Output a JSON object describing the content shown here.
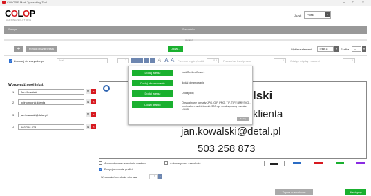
{
  "window": {
    "title": "COLOP E-Mark Typesetting Tool",
    "controls": [
      "–",
      "□",
      "×"
    ]
  },
  "brand": {
    "logo_text": "COLOP",
    "tagline": "MARKING SOLUTIONS"
  },
  "language": {
    "label": "Język",
    "value": "Polski"
  },
  "topbar": {
    "left_tab": "Stempel",
    "center_tab": "Stanowisko"
  },
  "section_label": "stempel",
  "toolbar": {
    "plus_label": "+",
    "new_text_button": "Ponad obszar tekstu",
    "add_button": "Dodaj...",
    "select_element_label": "Wybierz element",
    "select_element_value": "Tekst(1)",
    "font_label": "Szafka",
    "font_value": "—"
  },
  "options_row": {
    "apply_all_label": "Zastosuj do wszystkiego",
    "font_field_placeholder": "Arial",
    "size_value": "7",
    "move_up_down_label": "Przesuń w górę/w dół",
    "move_up_down_value": "0.5",
    "move_horizontal_label": "Przesuń w lewo/prawo",
    "move_horizontal_value": "0",
    "line_spacing_label": "Odstęp między znakami",
    "line_spacing_value": "0"
  },
  "left_panel": {
    "title": "Wprowadź swój tekst:",
    "rows": [
      {
        "num": "1",
        "value": "Jan Kowalski"
      },
      {
        "num": "2",
        "value": "pełnomocnik klienta"
      },
      {
        "num": "3",
        "value": "jan.kowalski@detal.pl"
      },
      {
        "num": "4",
        "value": "503 258 873"
      }
    ]
  },
  "preview": {
    "lines": [
      "lski",
      "klienta",
      "jan.kowalski@detal.pl",
      "503 258 873"
    ]
  },
  "popup": {
    "items": [
      {
        "button": "Dodaj wiersz",
        "desc": "<addTextlineDescr>"
      },
      {
        "button": "Dodaj obramowanie",
        "desc": "dodaj obramowanie"
      },
      {
        "button": "Dodaj wiersz",
        "desc": "Dodaj linię"
      },
      {
        "button": "Dodaj grafikę",
        "desc": "Obsługiwane formaty JPG, GIF, PNG, TIF, TIFF,BMP,SVG - minimalna rozdzielczość: 300 dpi - maksymalny rozmiar: ~5MB"
      }
    ],
    "close_label": "Anuluj"
  },
  "bottom_options": {
    "auto_setting_label": "Automatyczne ustawienie wartości",
    "auto_width_label": "Automatyczna szerokość",
    "position_graphics_label": "Pozycjonowanie grafiki",
    "height_label": "Wysokość/szerokość wiersza",
    "height_value": "1"
  },
  "swatches": [
    "#222222",
    "#2b6cc4",
    "#d71920",
    "#1ab02f",
    "#8a2be2"
  ],
  "footer": {
    "save_button": "Zapisz w archiwum",
    "next_button": "Następny"
  },
  "colors": {
    "accent_green": "#1ab02f",
    "brand_red": "#d71920"
  }
}
